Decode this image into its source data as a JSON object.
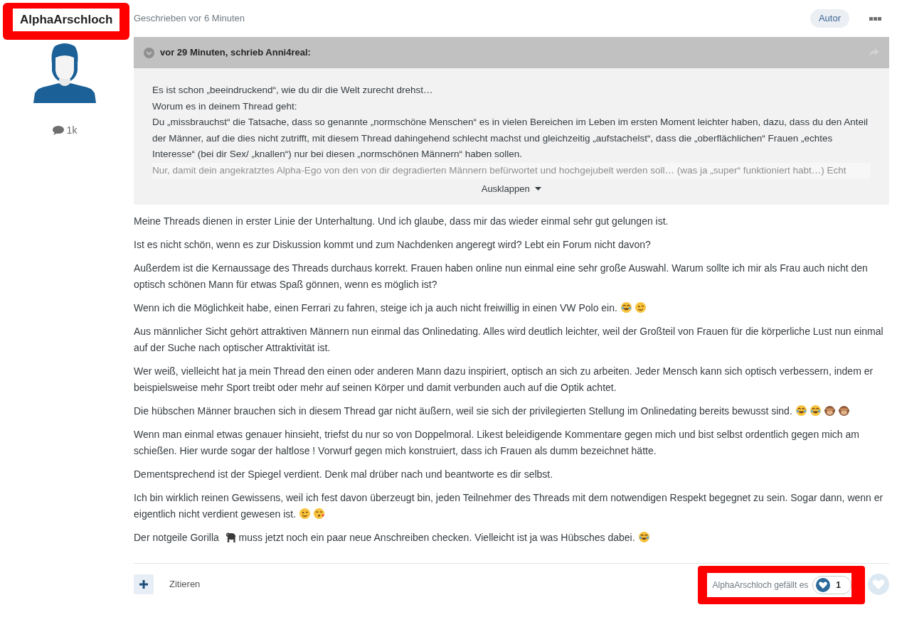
{
  "author": {
    "name": "AlphaArschloch",
    "post_count": "1k"
  },
  "post_meta": {
    "time": "Geschrieben vor 6 Minuten",
    "badge": "Autor"
  },
  "quote": {
    "header": "vor 29 Minuten, schrieb Anni4real:",
    "expanded": false,
    "lines": [
      "Es ist schon „beeindruckend“, wie du dir die Welt zurecht drehst…",
      "Worum es in deinem Thread geht:",
      "Du „missbrauchst“ die Tatsache, dass so genannte „normschöne Menschen“ es in vielen Bereichen im Leben im ersten Moment leichter haben, dazu, dass du den Anteil der Männer, auf die dies nicht zutrifft, mit diesem Thread dahingehend schlecht machst und gleichzeitig „aufstachelst“, dass die „oberflächlichen“ Frauen „echtes Interesse“ (bei dir Sex/ „knallen“) nur bei diesen „normschönen Männern“ haben sollen.",
      "Nur, damit dein angekratztes Alpha-Ego von den von dir degradierten Männern befürwortet und hochgejubelt werden soll… (was ja „super“ funktioniert habt…) Echt"
    ],
    "toggle": "Ausklappen"
  },
  "paragraphs": [
    {
      "parts": [
        {
          "text": "Meine Threads dienen in erster Linie der Unterhaltung. Und ich glaube, dass mir das wieder einmal sehr gut gelungen ist."
        }
      ]
    },
    {
      "parts": [
        {
          "text": "Ist es nicht schön, wenn es zur Diskussion kommt und zum Nachdenken angeregt wird? Lebt ein Forum nicht davon?"
        }
      ]
    },
    {
      "parts": [
        {
          "text": "Außerdem ist die Kernaussage des Threads durchaus korrekt. Frauen haben online nun einmal eine sehr große Auswahl. Warum sollte ich mir als Frau auch nicht den optisch schönen Mann für etwas Spaß gönnen, wenn es möglich ist?"
        }
      ]
    },
    {
      "parts": [
        {
          "text": "Wenn ich die Möglichkeit habe, einen Ferrari zu fahren, steige ich ja auch nicht freiwillig in einen VW Polo ein."
        },
        {
          "kind": "laughing"
        },
        {
          "kind": "winking"
        }
      ]
    },
    {
      "parts": [
        {
          "text": "Aus männlicher Sicht gehört attraktiven Männern nun einmal das Onlinedating. Alles wird deutlich leichter, weil der Großteil von Frauen für die körperliche Lust nun einmal auf der Suche nach optischer Attraktivität ist."
        }
      ]
    },
    {
      "parts": [
        {
          "text": "Wer weiß, vielleicht hat ja mein Thread den einen oder anderen Mann dazu inspiriert, optisch an sich zu arbeiten. Jeder Mensch kann sich optisch verbessern, indem er beispielsweise mehr Sport treibt oder mehr auf seinen Körper und damit verbunden auch auf die Optik achtet."
        }
      ]
    },
    {
      "parts": [
        {
          "text": "Die hübschen Männer brauchen sich in diesem Thread gar nicht äußern, weil sie sich der privilegierten Stellung im Onlinedating bereits bewusst sind."
        },
        {
          "kind": "laughing"
        },
        {
          "kind": "laughing"
        },
        {
          "kind": "monkey"
        },
        {
          "kind": "monkey"
        }
      ]
    },
    {
      "parts": [
        {
          "text": "Wenn man einmal etwas genauer hinsieht, triefst du nur so von Doppelmoral. Likest beleidigende Kommentare gegen mich und bist selbst ordentlich gegen mich am schießen. Hier wurde sogar der haltlose ! Vorwurf gegen mich konstruiert, dass ich Frauen als dumm bezeichnet hätte."
        }
      ]
    },
    {
      "parts": [
        {
          "text": "Dementsprechend ist der Spiegel verdient. Denk mal drüber nach und beantworte es dir selbst."
        }
      ]
    },
    {
      "parts": [
        {
          "text": "Ich bin wirklich reinen Gewissens, weil ich fest davon überzeugt bin, jeden Teilnehmer des Threads mit dem notwendigen Respekt begegnet zu sein. Sogar dann, wenn er eigentlich nicht verdient gewesen ist."
        },
        {
          "kind": "winking"
        },
        {
          "kind": "kissing"
        }
      ]
    },
    {
      "parts": [
        {
          "text": "Der notgeile Gorilla"
        },
        {
          "kind": "gorilla"
        },
        {
          "text": "muss jetzt noch ein paar neue Anschreiben checken. Vielleicht ist ja was Hübsches dabei."
        },
        {
          "kind": "laughing"
        }
      ]
    }
  ],
  "footer": {
    "quote_button": "Zitieren",
    "likes_text": "AlphaArschloch gefällt es",
    "like_count": "1",
    "liked": false
  }
}
